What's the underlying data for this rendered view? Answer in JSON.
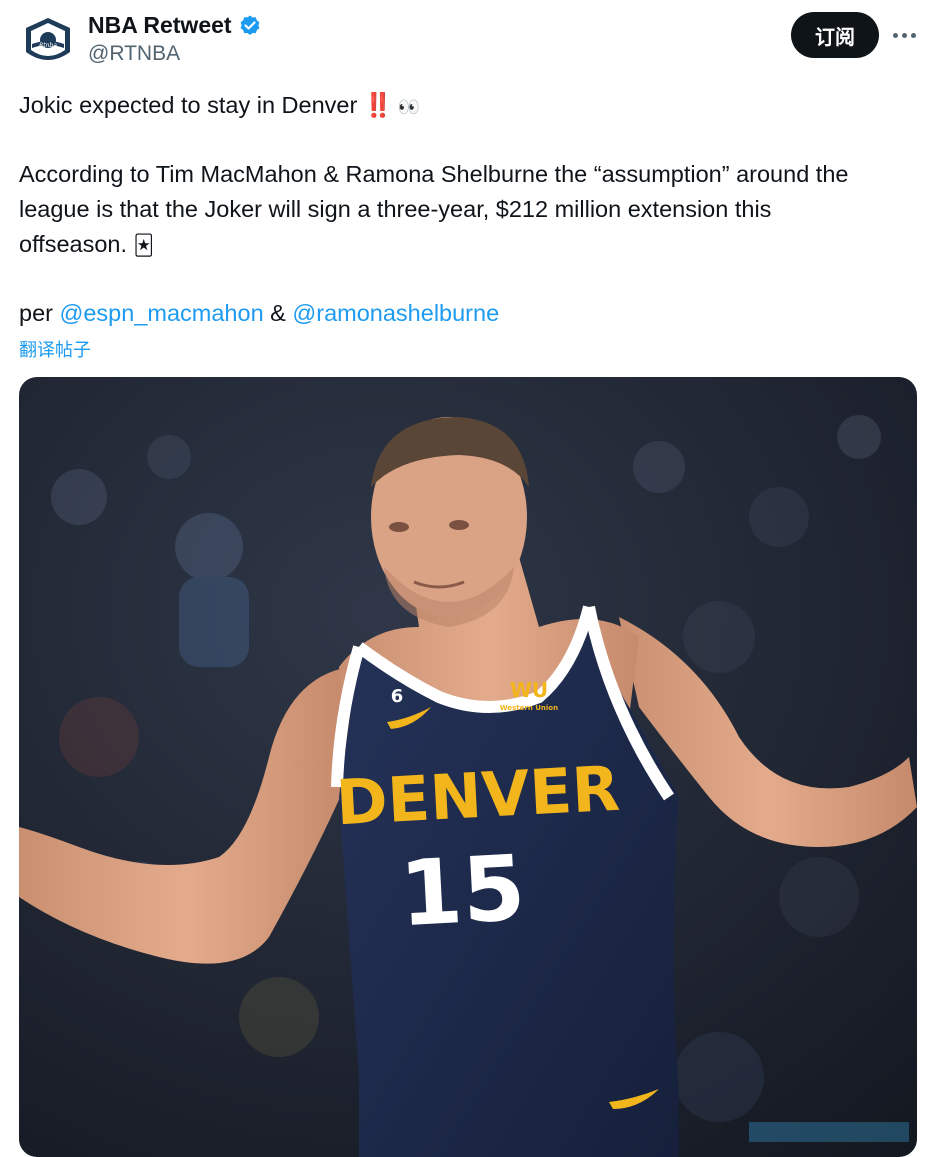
{
  "account": {
    "display_name": "NBA Retweet",
    "handle": "@RTNBA",
    "avatar_icon": "rtnba-logo",
    "verified_icon": "verified-badge-icon",
    "verified_color": "#1d9bf0"
  },
  "actions": {
    "subscribe_label": "订阅",
    "more_icon": "more-dots-icon"
  },
  "tweet": {
    "line1": "Jokic expected to stay in Denver",
    "line1_emoji_bang": "‼️",
    "line1_emoji_eyes": "👀",
    "paragraph2_line1": "According to Tim MacMahon & Ramona Shelburne the “assumption” around the",
    "paragraph2_line2": "league is that the Joker will sign a three-year, $212 million extension this",
    "paragraph2_line3": "offseason.",
    "paragraph2_emoji": "🃏",
    "mentions_prefix": "per",
    "mention1": "@espn_macmahon",
    "mentions_joiner": "&",
    "mention2": "@ramonashelburne",
    "translate_label": "翻译帖子"
  },
  "media": {
    "jersey_team": "DENVER",
    "jersey_number": "15",
    "jersey_patch": "WU",
    "jersey_patch_sub": "Western Union",
    "sleeve_number": "6",
    "colors": {
      "jersey": "#1d2a4a",
      "jersey_gold": "#f2b51b",
      "skin": "#d9a282",
      "background": "#1e2430"
    }
  },
  "colors": {
    "link": "#1d9bf0",
    "text": "#0f1419",
    "secondary_text": "#536471",
    "button_bg": "#0f1419"
  }
}
